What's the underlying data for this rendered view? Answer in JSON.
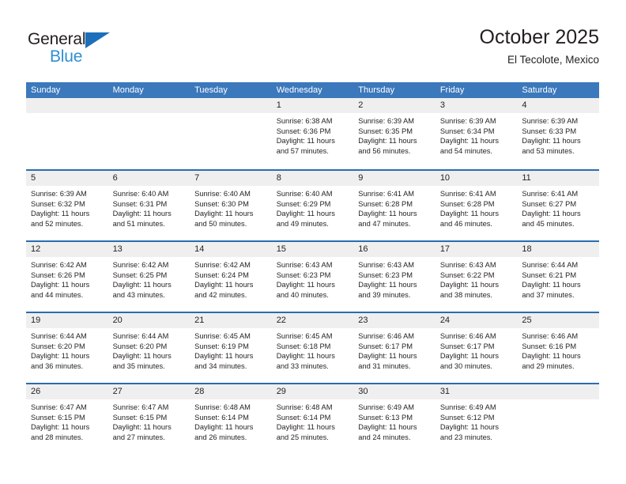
{
  "brand": {
    "word_one": "General",
    "word_two": "Blue",
    "triangle_icon": "triangle-icon",
    "accent_dark": "#1c6fba",
    "accent_light": "#2d8fd5"
  },
  "header": {
    "title": "October 2025",
    "subtitle": "El Tecolote, Mexico"
  },
  "theme": {
    "header_bar": "#3b78bc",
    "row_divider": "#2b6cb0",
    "date_band": "#efefef",
    "text": "#231f20"
  },
  "weekdays": [
    "Sunday",
    "Monday",
    "Tuesday",
    "Wednesday",
    "Thursday",
    "Friday",
    "Saturday"
  ],
  "weeks": [
    [
      {
        "date": "",
        "sunrise": "",
        "sunset": "",
        "daylight": "",
        "empty": true
      },
      {
        "date": "",
        "sunrise": "",
        "sunset": "",
        "daylight": "",
        "empty": true
      },
      {
        "date": "",
        "sunrise": "",
        "sunset": "",
        "daylight": "",
        "empty": true
      },
      {
        "date": "1",
        "sunrise": "Sunrise: 6:38 AM",
        "sunset": "Sunset: 6:36 PM",
        "daylight": "Daylight: 11 hours and 57 minutes.",
        "empty": false
      },
      {
        "date": "2",
        "sunrise": "Sunrise: 6:39 AM",
        "sunset": "Sunset: 6:35 PM",
        "daylight": "Daylight: 11 hours and 56 minutes.",
        "empty": false
      },
      {
        "date": "3",
        "sunrise": "Sunrise: 6:39 AM",
        "sunset": "Sunset: 6:34 PM",
        "daylight": "Daylight: 11 hours and 54 minutes.",
        "empty": false
      },
      {
        "date": "4",
        "sunrise": "Sunrise: 6:39 AM",
        "sunset": "Sunset: 6:33 PM",
        "daylight": "Daylight: 11 hours and 53 minutes.",
        "empty": false
      }
    ],
    [
      {
        "date": "5",
        "sunrise": "Sunrise: 6:39 AM",
        "sunset": "Sunset: 6:32 PM",
        "daylight": "Daylight: 11 hours and 52 minutes.",
        "empty": false
      },
      {
        "date": "6",
        "sunrise": "Sunrise: 6:40 AM",
        "sunset": "Sunset: 6:31 PM",
        "daylight": "Daylight: 11 hours and 51 minutes.",
        "empty": false
      },
      {
        "date": "7",
        "sunrise": "Sunrise: 6:40 AM",
        "sunset": "Sunset: 6:30 PM",
        "daylight": "Daylight: 11 hours and 50 minutes.",
        "empty": false
      },
      {
        "date": "8",
        "sunrise": "Sunrise: 6:40 AM",
        "sunset": "Sunset: 6:29 PM",
        "daylight": "Daylight: 11 hours and 49 minutes.",
        "empty": false
      },
      {
        "date": "9",
        "sunrise": "Sunrise: 6:41 AM",
        "sunset": "Sunset: 6:28 PM",
        "daylight": "Daylight: 11 hours and 47 minutes.",
        "empty": false
      },
      {
        "date": "10",
        "sunrise": "Sunrise: 6:41 AM",
        "sunset": "Sunset: 6:28 PM",
        "daylight": "Daylight: 11 hours and 46 minutes.",
        "empty": false
      },
      {
        "date": "11",
        "sunrise": "Sunrise: 6:41 AM",
        "sunset": "Sunset: 6:27 PM",
        "daylight": "Daylight: 11 hours and 45 minutes.",
        "empty": false
      }
    ],
    [
      {
        "date": "12",
        "sunrise": "Sunrise: 6:42 AM",
        "sunset": "Sunset: 6:26 PM",
        "daylight": "Daylight: 11 hours and 44 minutes.",
        "empty": false
      },
      {
        "date": "13",
        "sunrise": "Sunrise: 6:42 AM",
        "sunset": "Sunset: 6:25 PM",
        "daylight": "Daylight: 11 hours and 43 minutes.",
        "empty": false
      },
      {
        "date": "14",
        "sunrise": "Sunrise: 6:42 AM",
        "sunset": "Sunset: 6:24 PM",
        "daylight": "Daylight: 11 hours and 42 minutes.",
        "empty": false
      },
      {
        "date": "15",
        "sunrise": "Sunrise: 6:43 AM",
        "sunset": "Sunset: 6:23 PM",
        "daylight": "Daylight: 11 hours and 40 minutes.",
        "empty": false
      },
      {
        "date": "16",
        "sunrise": "Sunrise: 6:43 AM",
        "sunset": "Sunset: 6:23 PM",
        "daylight": "Daylight: 11 hours and 39 minutes.",
        "empty": false
      },
      {
        "date": "17",
        "sunrise": "Sunrise: 6:43 AM",
        "sunset": "Sunset: 6:22 PM",
        "daylight": "Daylight: 11 hours and 38 minutes.",
        "empty": false
      },
      {
        "date": "18",
        "sunrise": "Sunrise: 6:44 AM",
        "sunset": "Sunset: 6:21 PM",
        "daylight": "Daylight: 11 hours and 37 minutes.",
        "empty": false
      }
    ],
    [
      {
        "date": "19",
        "sunrise": "Sunrise: 6:44 AM",
        "sunset": "Sunset: 6:20 PM",
        "daylight": "Daylight: 11 hours and 36 minutes.",
        "empty": false
      },
      {
        "date": "20",
        "sunrise": "Sunrise: 6:44 AM",
        "sunset": "Sunset: 6:20 PM",
        "daylight": "Daylight: 11 hours and 35 minutes.",
        "empty": false
      },
      {
        "date": "21",
        "sunrise": "Sunrise: 6:45 AM",
        "sunset": "Sunset: 6:19 PM",
        "daylight": "Daylight: 11 hours and 34 minutes.",
        "empty": false
      },
      {
        "date": "22",
        "sunrise": "Sunrise: 6:45 AM",
        "sunset": "Sunset: 6:18 PM",
        "daylight": "Daylight: 11 hours and 33 minutes.",
        "empty": false
      },
      {
        "date": "23",
        "sunrise": "Sunrise: 6:46 AM",
        "sunset": "Sunset: 6:17 PM",
        "daylight": "Daylight: 11 hours and 31 minutes.",
        "empty": false
      },
      {
        "date": "24",
        "sunrise": "Sunrise: 6:46 AM",
        "sunset": "Sunset: 6:17 PM",
        "daylight": "Daylight: 11 hours and 30 minutes.",
        "empty": false
      },
      {
        "date": "25",
        "sunrise": "Sunrise: 6:46 AM",
        "sunset": "Sunset: 6:16 PM",
        "daylight": "Daylight: 11 hours and 29 minutes.",
        "empty": false
      }
    ],
    [
      {
        "date": "26",
        "sunrise": "Sunrise: 6:47 AM",
        "sunset": "Sunset: 6:15 PM",
        "daylight": "Daylight: 11 hours and 28 minutes.",
        "empty": false
      },
      {
        "date": "27",
        "sunrise": "Sunrise: 6:47 AM",
        "sunset": "Sunset: 6:15 PM",
        "daylight": "Daylight: 11 hours and 27 minutes.",
        "empty": false
      },
      {
        "date": "28",
        "sunrise": "Sunrise: 6:48 AM",
        "sunset": "Sunset: 6:14 PM",
        "daylight": "Daylight: 11 hours and 26 minutes.",
        "empty": false
      },
      {
        "date": "29",
        "sunrise": "Sunrise: 6:48 AM",
        "sunset": "Sunset: 6:14 PM",
        "daylight": "Daylight: 11 hours and 25 minutes.",
        "empty": false
      },
      {
        "date": "30",
        "sunrise": "Sunrise: 6:49 AM",
        "sunset": "Sunset: 6:13 PM",
        "daylight": "Daylight: 11 hours and 24 minutes.",
        "empty": false
      },
      {
        "date": "31",
        "sunrise": "Sunrise: 6:49 AM",
        "sunset": "Sunset: 6:12 PM",
        "daylight": "Daylight: 11 hours and 23 minutes.",
        "empty": false
      },
      {
        "date": "",
        "sunrise": "",
        "sunset": "",
        "daylight": "",
        "empty": true
      }
    ]
  ]
}
